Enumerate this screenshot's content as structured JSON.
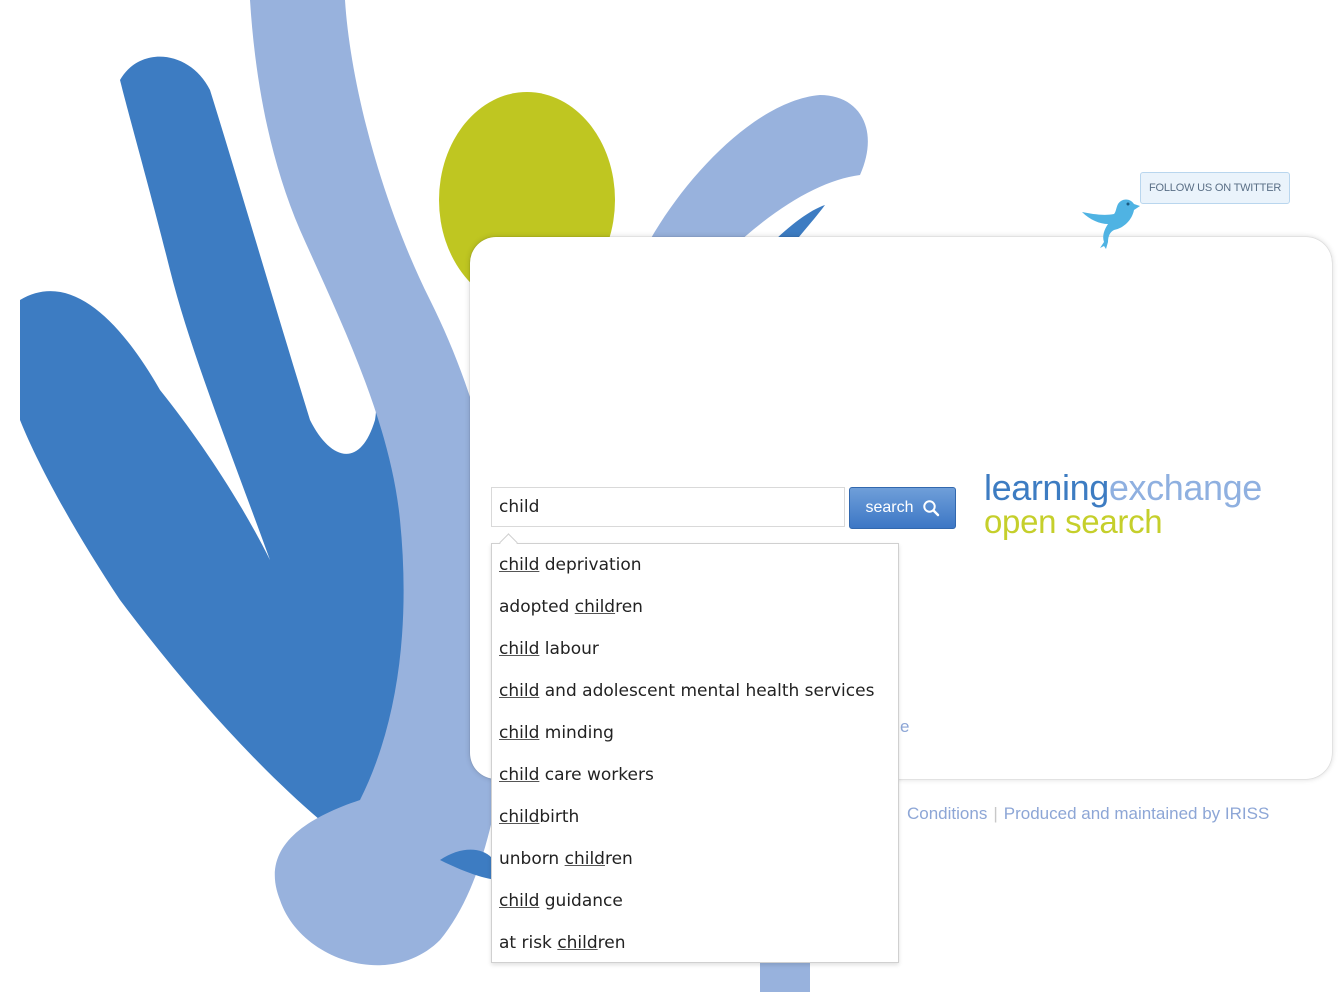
{
  "search": {
    "value": "child",
    "button_label": "search"
  },
  "brand": {
    "part1": "learning",
    "part2": "exchange",
    "tagline": "open search"
  },
  "twitter": {
    "label": "FOLLOW US ON TWITTER"
  },
  "suggestions": [
    {
      "before": "",
      "match": "child",
      "after": " deprivation"
    },
    {
      "before": "adopted ",
      "match": "child",
      "after": "ren"
    },
    {
      "before": "",
      "match": "child",
      "after": " labour"
    },
    {
      "before": "",
      "match": "child",
      "after": " and adolescent mental health services"
    },
    {
      "before": "",
      "match": "child",
      "after": " minding"
    },
    {
      "before": "",
      "match": "child",
      "after": " care workers"
    },
    {
      "before": "",
      "match": "child",
      "after": "birth"
    },
    {
      "before": "unborn ",
      "match": "child",
      "after": "ren"
    },
    {
      "before": "",
      "match": "child",
      "after": " guidance"
    },
    {
      "before": "at risk ",
      "match": "child",
      "after": "ren"
    }
  ],
  "partial_link": "e",
  "footer": {
    "conditions": "Conditions",
    "produced_by": "Produced and maintained by IRISS"
  },
  "colors": {
    "dark_blue": "#3d7cc2",
    "light_blue": "#98b2dd",
    "lime": "#bfc621",
    "twitter_blue": "#4fb3e3"
  },
  "icons": [
    "twitter-bird-icon",
    "search-icon"
  ]
}
